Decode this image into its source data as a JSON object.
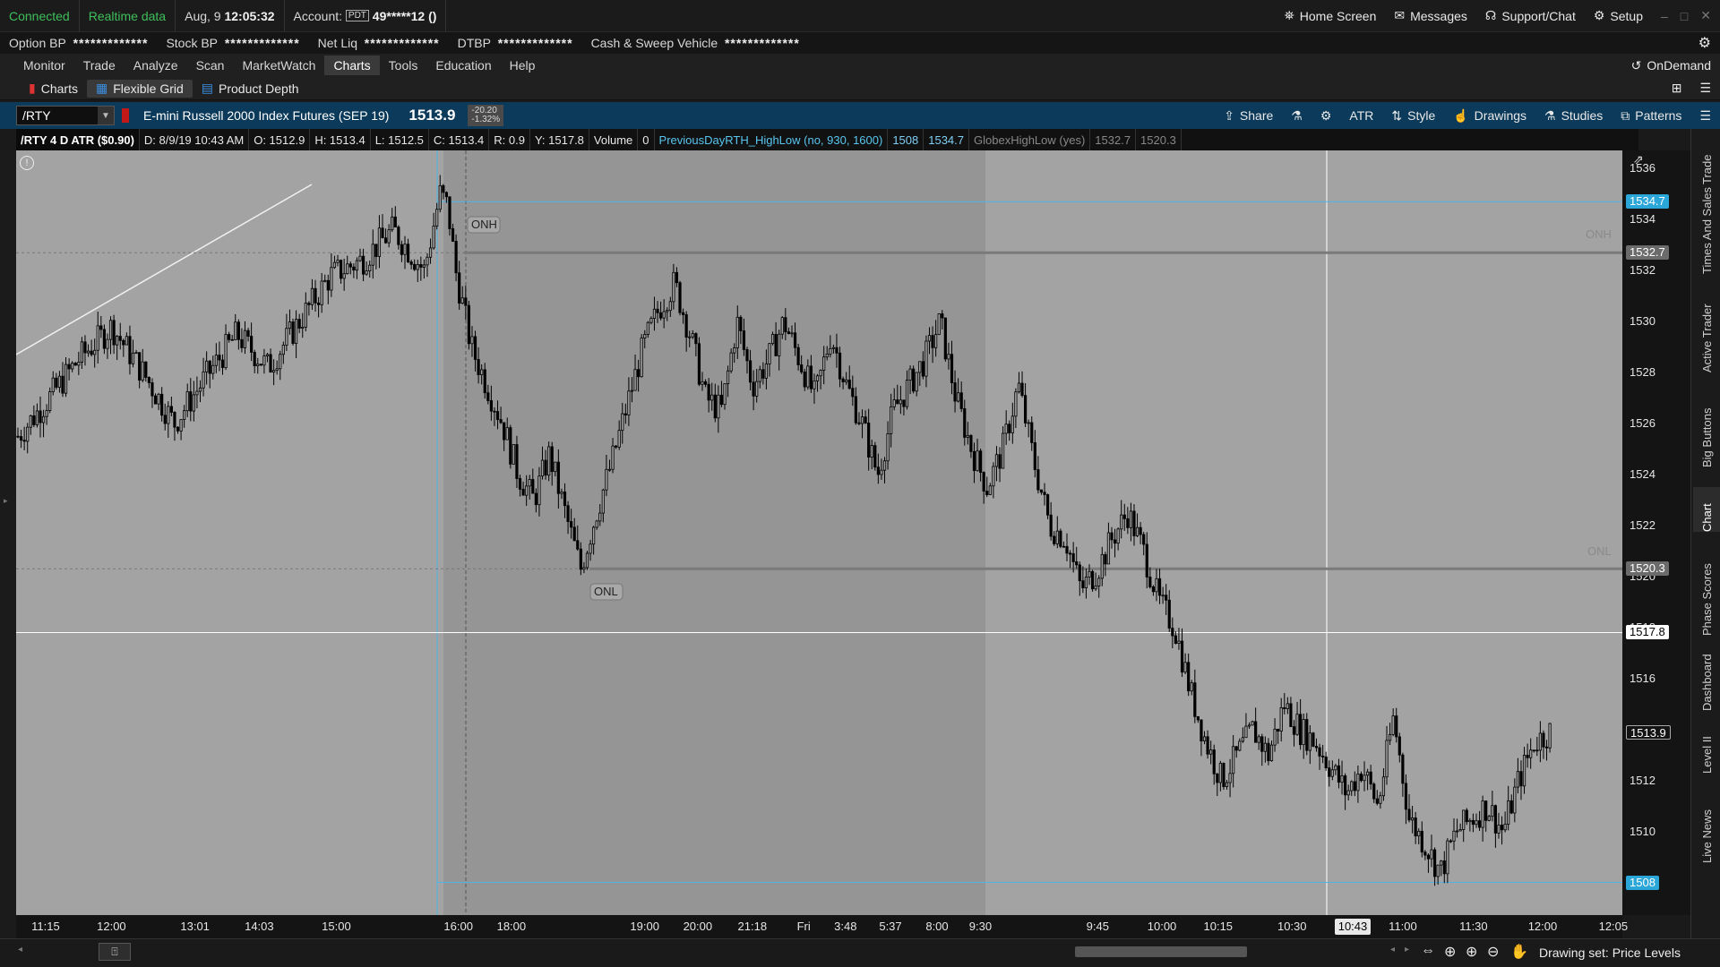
{
  "status": {
    "connection": "Connected",
    "data_feed": "Realtime data",
    "date": "Aug, 9",
    "time": "12:05:32",
    "account_label": "Account:",
    "account_badge": "PDT",
    "account_number": "49*****12 ()",
    "home_screen": "Home Screen",
    "messages": "Messages",
    "support": "Support/Chat",
    "setup": "Setup",
    "ondemand": "OnDemand"
  },
  "account_bar": {
    "items": [
      {
        "label": "Option BP",
        "value": "*************"
      },
      {
        "label": "Stock BP",
        "value": "*************"
      },
      {
        "label": "Net Liq",
        "value": "*************"
      },
      {
        "label": "DTBP",
        "value": "*************"
      },
      {
        "label": "Cash & Sweep Vehicle",
        "value": "*************"
      }
    ]
  },
  "menu": {
    "items": [
      "Monitor",
      "Trade",
      "Analyze",
      "Scan",
      "MarketWatch",
      "Charts",
      "Tools",
      "Education",
      "Help"
    ],
    "active": "Charts"
  },
  "sub_tabs": [
    "Charts",
    "Flexible Grid",
    "Product Depth"
  ],
  "symbol_bar": {
    "symbol": "/RTY",
    "description": "E-mini Russell 2000 Index Futures (SEP 19)",
    "last": "1513.9",
    "change": "-20.20",
    "change_pct": "-1.32%",
    "buttons": [
      "Share",
      "ATR",
      "Style",
      "Drawings",
      "Studies",
      "Patterns"
    ]
  },
  "study_bar": {
    "cells": [
      "/RTY 4 D ATR ($0.90)",
      "D: 8/9/19 10:43 AM",
      "O: 1512.9",
      "H: 1513.4",
      "L: 1512.5",
      "C: 1513.4",
      "R: 0.9",
      "Y: 1517.8",
      "Volume",
      "0",
      "PreviousDayRTH_HighLow (no, 930, 1600)",
      "1508",
      "1534.7",
      "GlobexHighLow (yes)",
      "1532.7",
      "1520.3"
    ]
  },
  "chart": {
    "annotations": {
      "onh": "ONH",
      "onl": "ONL",
      "onh_right": "ONH",
      "onl_right": "ONL"
    },
    "price_badges": [
      {
        "text": "1534.7",
        "color": "#2aa6d8",
        "text_color": "#ffffff"
      },
      {
        "text": "1532.7",
        "color": "#6b6b6b",
        "text_color": "#ffffff"
      },
      {
        "text": "1520.3",
        "color": "#6b6b6b",
        "text_color": "#ffffff"
      },
      {
        "text": "1517.8",
        "color": "#ffffff",
        "text_color": "#000000"
      },
      {
        "text": "1513.9",
        "color": "#141414",
        "text_color": "#ffffff"
      },
      {
        "text": "1508",
        "color": "#2aa6d8",
        "text_color": "#ffffff"
      }
    ],
    "cursor_time": "10:43"
  },
  "chart_data": {
    "type": "candlestick",
    "symbol": "/RTY",
    "y_ticks": [
      1510,
      1512,
      1514,
      1516,
      1518,
      1520,
      1522,
      1524,
      1526,
      1528,
      1530,
      1532,
      1534,
      1536
    ],
    "ylim": [
      1507,
      1536.5
    ],
    "x_ticks": [
      "11:15",
      "12:00",
      "13:01",
      "14:03",
      "15:00",
      "16:00",
      "18:00",
      "19:00",
      "20:00",
      "21:18",
      "Fri",
      "3:48",
      "5:37",
      "8:00",
      "9:30",
      "9:45",
      "10:00",
      "10:15",
      "10:30",
      "11:00",
      "11:30",
      "12:00",
      "12:05"
    ],
    "price_path": [
      [
        0.0,
        1525.5
      ],
      [
        0.02,
        1527.0
      ],
      [
        0.04,
        1528.6
      ],
      [
        0.06,
        1529.8
      ],
      [
        0.08,
        1528.0
      ],
      [
        0.1,
        1526.0
      ],
      [
        0.12,
        1527.8
      ],
      [
        0.14,
        1529.5
      ],
      [
        0.16,
        1528.2
      ],
      [
        0.18,
        1530.0
      ],
      [
        0.2,
        1531.8
      ],
      [
        0.22,
        1532.4
      ],
      [
        0.24,
        1533.6
      ],
      [
        0.26,
        1532.0
      ],
      [
        0.27,
        1535.0
      ],
      [
        0.275,
        1534.5
      ],
      [
        0.28,
        1532.0
      ],
      [
        0.29,
        1529.0
      ],
      [
        0.3,
        1527.5
      ],
      [
        0.31,
        1526.0
      ],
      [
        0.32,
        1524.0
      ],
      [
        0.33,
        1523.0
      ],
      [
        0.34,
        1524.8
      ],
      [
        0.35,
        1522.5
      ],
      [
        0.36,
        1520.3
      ],
      [
        0.37,
        1522.5
      ],
      [
        0.38,
        1524.5
      ],
      [
        0.39,
        1526.8
      ],
      [
        0.4,
        1529.0
      ],
      [
        0.41,
        1530.5
      ],
      [
        0.42,
        1531.5
      ],
      [
        0.43,
        1529.5
      ],
      [
        0.44,
        1527.0
      ],
      [
        0.45,
        1526.5
      ],
      [
        0.46,
        1530.0
      ],
      [
        0.47,
        1527.5
      ],
      [
        0.48,
        1528.5
      ],
      [
        0.49,
        1530.0
      ],
      [
        0.5,
        1528.5
      ],
      [
        0.51,
        1527.0
      ],
      [
        0.52,
        1529.5
      ],
      [
        0.53,
        1527.5
      ],
      [
        0.54,
        1526.0
      ],
      [
        0.55,
        1524.0
      ],
      [
        0.56,
        1526.5
      ],
      [
        0.57,
        1527.5
      ],
      [
        0.58,
        1528.5
      ],
      [
        0.59,
        1530.0
      ],
      [
        0.6,
        1527.0
      ],
      [
        0.61,
        1525.0
      ],
      [
        0.62,
        1523.5
      ],
      [
        0.63,
        1525.0
      ],
      [
        0.64,
        1527.5
      ],
      [
        0.65,
        1524.5
      ],
      [
        0.66,
        1522.0
      ],
      [
        0.67,
        1521.5
      ],
      [
        0.68,
        1519.5
      ],
      [
        0.69,
        1520.2
      ],
      [
        0.7,
        1521.5
      ],
      [
        0.71,
        1522.5
      ],
      [
        0.72,
        1521.0
      ],
      [
        0.73,
        1519.0
      ],
      [
        0.74,
        1518.0
      ],
      [
        0.75,
        1515.5
      ],
      [
        0.76,
        1513.5
      ],
      [
        0.77,
        1512.0
      ],
      [
        0.78,
        1513.0
      ],
      [
        0.79,
        1514.0
      ],
      [
        0.8,
        1513.0
      ],
      [
        0.81,
        1515.0
      ],
      [
        0.82,
        1514.0
      ],
      [
        0.83,
        1513.5
      ],
      [
        0.84,
        1512.5
      ],
      [
        0.85,
        1511.5
      ],
      [
        0.86,
        1512.5
      ],
      [
        0.87,
        1511.0
      ],
      [
        0.88,
        1514.5
      ],
      [
        0.89,
        1510.5
      ],
      [
        0.9,
        1509.5
      ],
      [
        0.91,
        1508.4
      ],
      [
        0.92,
        1510.0
      ],
      [
        0.93,
        1510.5
      ],
      [
        0.94,
        1511.0
      ],
      [
        0.95,
        1510.0
      ],
      [
        0.96,
        1512.0
      ],
      [
        0.97,
        1513.5
      ],
      [
        0.98,
        1513.9
      ]
    ]
  },
  "right_tabs": [
    "Trade",
    "Times And Sales",
    "Active Trader",
    "Big Buttons",
    "Chart",
    "Phase Scores",
    "Dashboard",
    "Level II",
    "Live News"
  ],
  "bottom": {
    "drawing_set": "Drawing set: Price Levels"
  },
  "colors": {
    "accent_green": "#3fbf5a",
    "symbol_bar": "#0b3a5a",
    "chart_bg": "#a3a3a3",
    "chart_bg_dark": "#959595",
    "cyan_level": "#2aa6d8"
  }
}
